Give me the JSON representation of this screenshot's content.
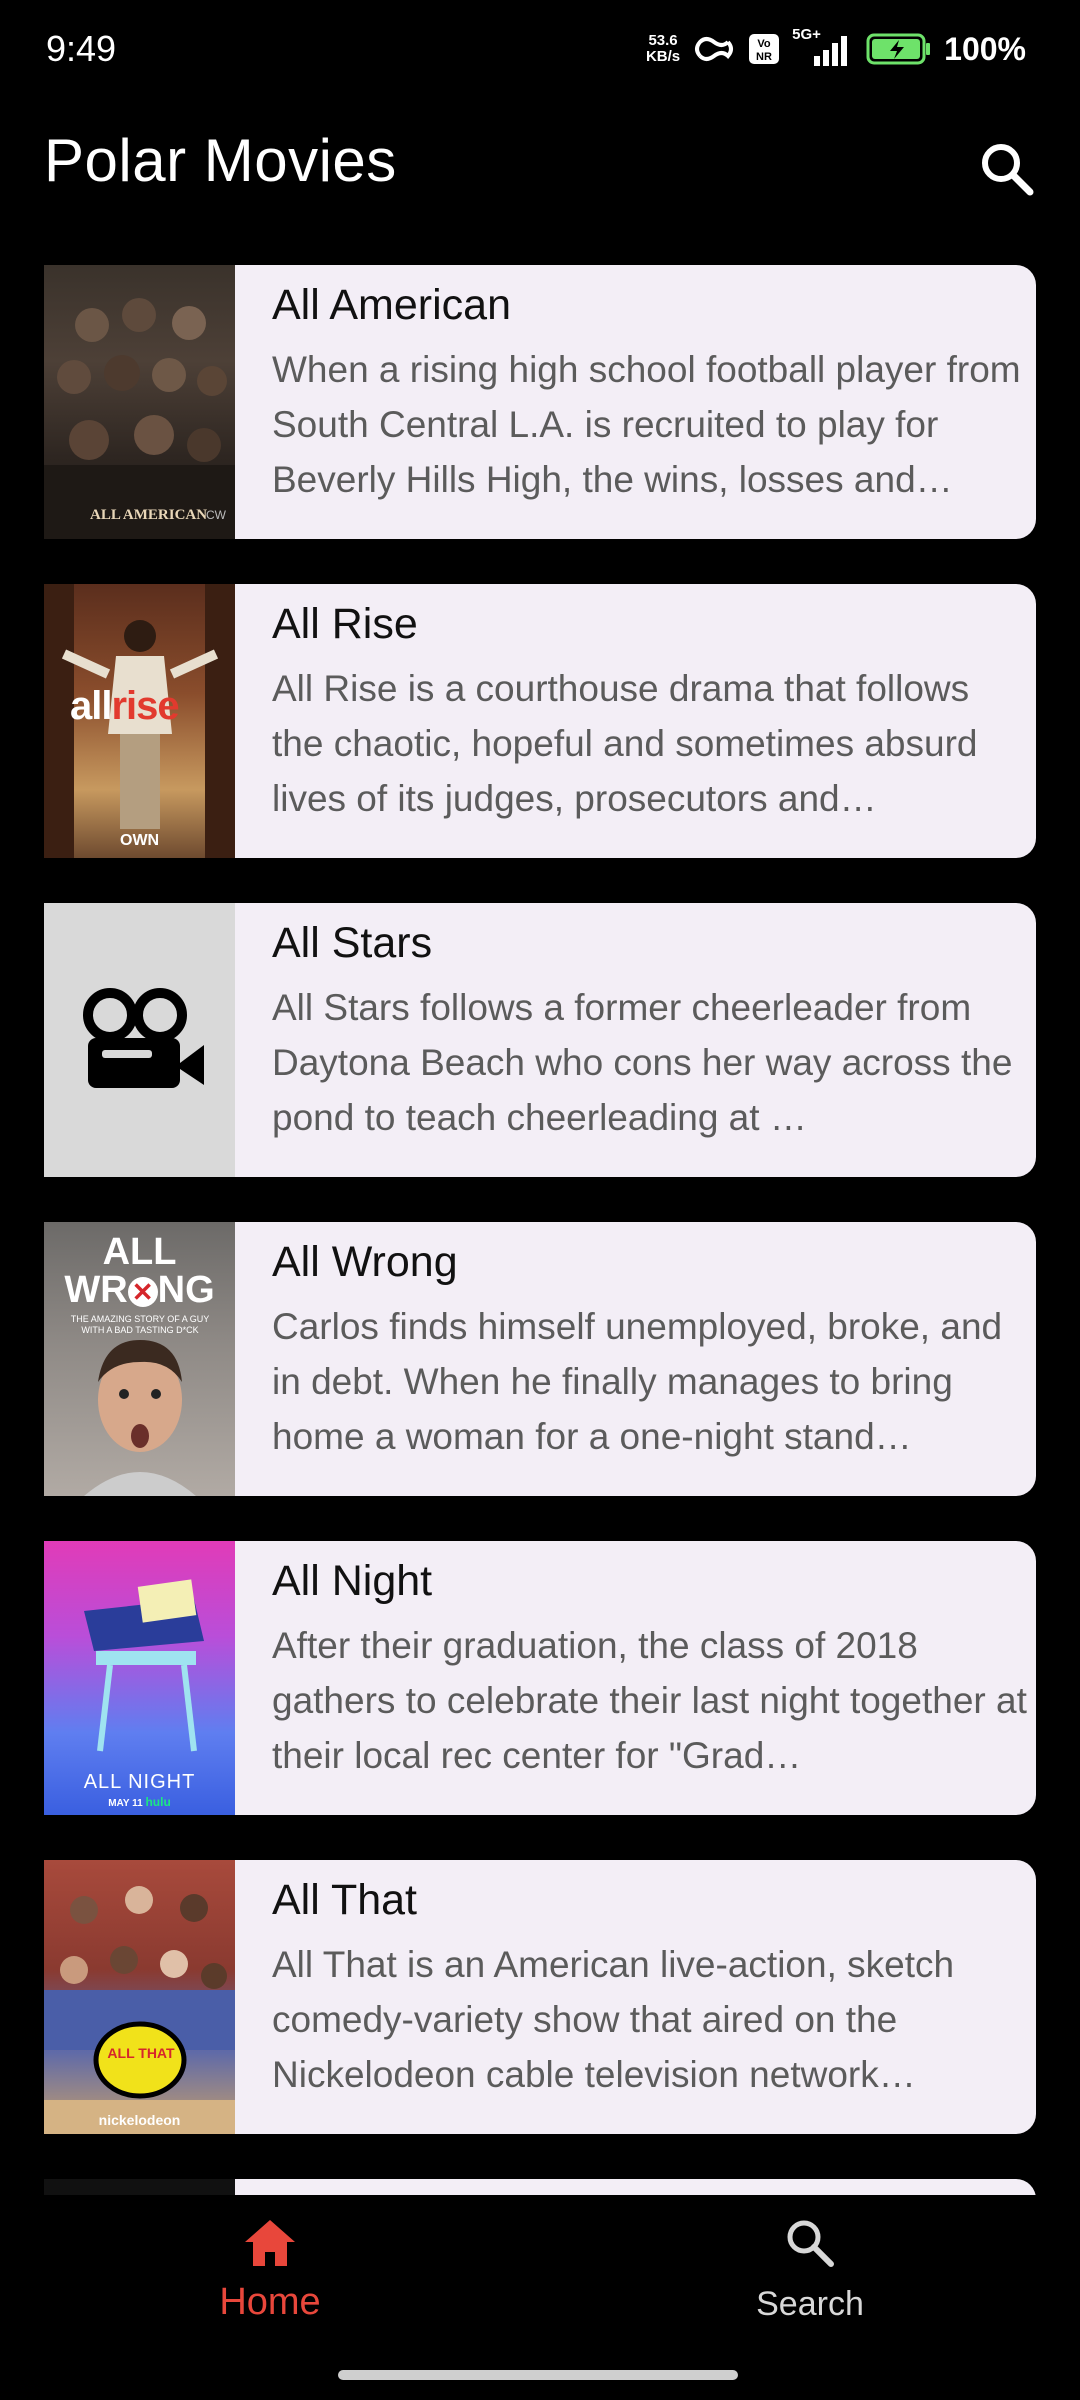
{
  "status_bar": {
    "time": "9:49",
    "net_speed_value": "53.6",
    "net_speed_unit": "KB/s",
    "network": "5G+",
    "battery": "100%"
  },
  "header": {
    "title": "Polar Movies",
    "search_icon": "search-icon"
  },
  "movies": [
    {
      "title": "All American",
      "description": "When a rising high school football player from South Central L.A. is recruited to play for Beverly Hills High, the wins, losses and…",
      "poster_text": "ALL AMERICAN",
      "poster_network": "CW"
    },
    {
      "title": "All Rise",
      "description": "All Rise is a courthouse drama that follows the chaotic, hopeful and sometimes absurd lives of its judges, prosecutors and…",
      "poster_text_all": "all",
      "poster_text_rise": "rise",
      "poster_network": "OWN"
    },
    {
      "title": "All Stars",
      "description": "All Stars follows a former cheerleader from Daytona Beach who cons her way across the pond to teach cheerleading at …",
      "poster_icon": "movie-camera-icon"
    },
    {
      "title": "All Wrong",
      "description": "Carlos finds himself unemployed, broke, and in debt. When he finally manages to bring home a woman for a one-night stand…",
      "poster_line1": "ALL",
      "poster_line2": "WR",
      "poster_line3": "NG",
      "poster_tagline": "THE AMAZING STORY OF A GUY WITH A BAD TASTING D*CK"
    },
    {
      "title": "All Night",
      "description": "After their graduation, the class of 2018 gathers to celebrate their last night together at their local rec center for \"Grad…",
      "poster_text": "ALL NIGHT",
      "poster_date": "MAY 11",
      "poster_network": "hulu"
    },
    {
      "title": "All That",
      "description": "All That is an American live-action, sketch comedy-variety show that aired on the Nickelodeon cable television network featuring…",
      "poster_text": "ALL THAT",
      "poster_network": "nickelodeon"
    }
  ],
  "bottom_nav": {
    "home_label": "Home",
    "search_label": "Search"
  },
  "colors": {
    "background": "#000000",
    "card": "#f3eef6",
    "accent": "#e8473b",
    "title_text": "#111111",
    "desc_text": "#5b5b5b"
  }
}
